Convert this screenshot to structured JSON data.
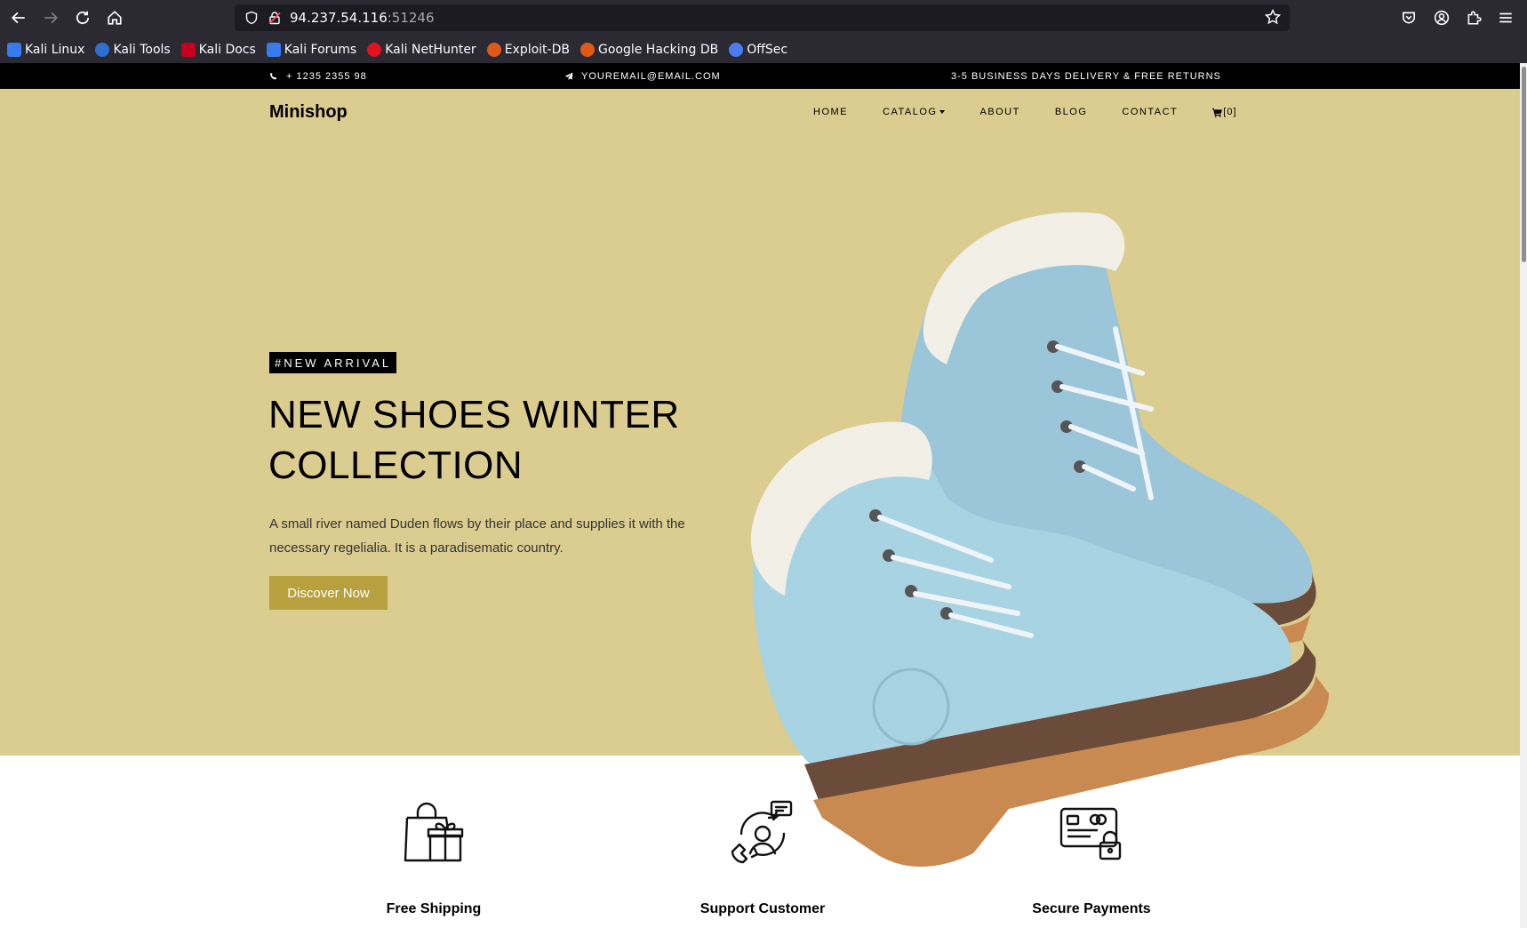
{
  "browser": {
    "url_host": "94.237.54.116",
    "url_port": ":51246",
    "bookmarks": [
      {
        "label": "Kali Linux",
        "color": "#367bf0"
      },
      {
        "label": "Kali Tools",
        "color": "#2f6fd1"
      },
      {
        "label": "Kali Docs",
        "color": "#c8001e"
      },
      {
        "label": "Kali Forums",
        "color": "#367bf0"
      },
      {
        "label": "Kali NetHunter",
        "color": "#e0121d"
      },
      {
        "label": "Exploit-DB",
        "color": "#e05a17"
      },
      {
        "label": "Google Hacking DB",
        "color": "#e05a17"
      },
      {
        "label": "OffSec",
        "color": "#4a7cf0"
      }
    ]
  },
  "topbar": {
    "phone": "+ 1235 2355 98",
    "email": "YOUREMAIL@EMAIL.COM",
    "delivery": "3-5 BUSINESS DAYS DELIVERY & FREE RETURNS"
  },
  "nav": {
    "brand": "Minishop",
    "items": [
      "HOME",
      "CATALOG",
      "ABOUT",
      "BLOG",
      "CONTACT"
    ],
    "cart": "[0]"
  },
  "hero": {
    "tag": "#NEW ARRIVAL",
    "title": "NEW SHOES WINTER COLLECTION",
    "description": "A small river named Duden flows by their place and supplies it with the necessary regelialia. It is a paradisematic country.",
    "cta": "Discover Now",
    "background": "#dbcc8f",
    "cta_color": "#b6a13e"
  },
  "features": [
    {
      "title": "Free Shipping",
      "icon": "shopping-bag-gift-icon"
    },
    {
      "title": "Support Customer",
      "icon": "customer-support-icon"
    },
    {
      "title": "Secure Payments",
      "icon": "secure-payment-card-icon"
    }
  ]
}
